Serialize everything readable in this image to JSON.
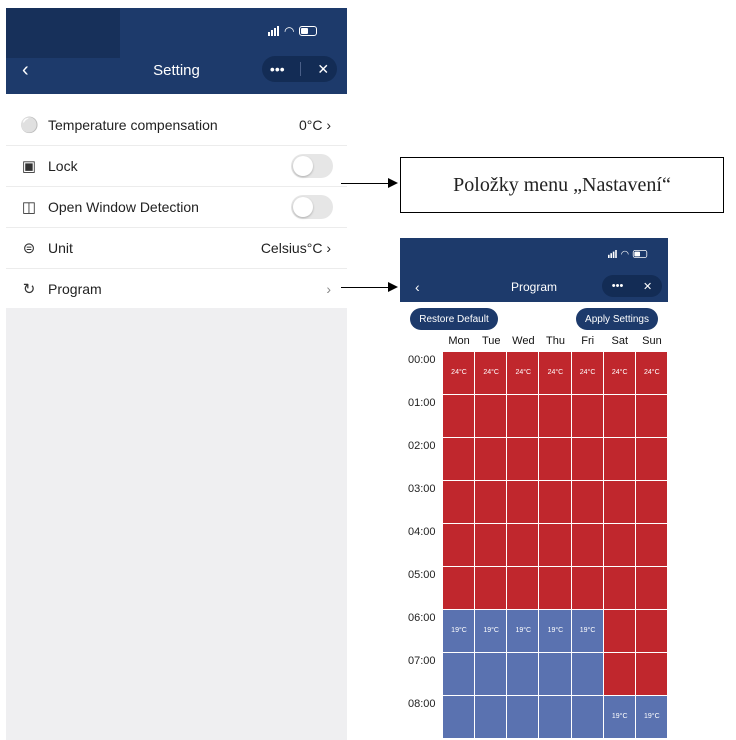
{
  "left_phone": {
    "title": "Setting",
    "capsule": {
      "more_icon": "•••",
      "close_icon": "✕"
    },
    "items": [
      {
        "icon": "thermometer-icon",
        "label": "Temperature compensation",
        "value": "0°C",
        "type": "link"
      },
      {
        "icon": "lock-icon",
        "label": "Lock",
        "type": "toggle",
        "on": false
      },
      {
        "icon": "window-icon",
        "label": "Open Window Detection",
        "type": "toggle",
        "on": false
      },
      {
        "icon": "unit-icon",
        "label": "Unit",
        "value": "Celsius°C",
        "type": "link"
      },
      {
        "icon": "clock-icon",
        "label": "Program",
        "value": "",
        "type": "link"
      }
    ]
  },
  "callout": {
    "text": "Položky menu „Nastavení“"
  },
  "right_phone": {
    "title": "Program",
    "capsule": {
      "more_icon": "•••",
      "close_icon": "✕"
    },
    "buttons": {
      "restore": "Restore Default",
      "apply": "Apply Settings"
    },
    "days": [
      "Mon",
      "Tue",
      "Wed",
      "Thu",
      "Fri",
      "Sat",
      "Sun"
    ],
    "times": [
      "00:00",
      "01:00",
      "02:00",
      "03:00",
      "04:00",
      "05:00",
      "06:00",
      "07:00",
      "08:00"
    ],
    "temps": {
      "comfort": "24°C",
      "eco": "19°C"
    },
    "colors": {
      "comfort": "#c0272d",
      "eco": "#5a72b0",
      "header": "#1d3a6b"
    },
    "schedule_switch_hours": {
      "Mon": 6,
      "Tue": 6,
      "Wed": 6,
      "Thu": 6,
      "Fri": 6,
      "Sat": 8,
      "Sun": 8
    }
  }
}
